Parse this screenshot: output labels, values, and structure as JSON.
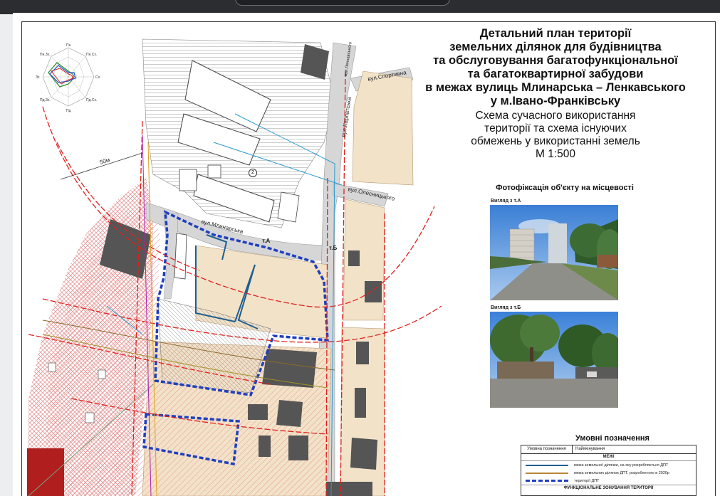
{
  "title": {
    "line1": "Детальний план території",
    "line2": "земельних ділянок для будівництва",
    "line3": "та обслуговування багатофункціональної",
    "line4": "та багатоквартирної забудови",
    "line5": "в межах вулиць Млинарська – Ленкавського",
    "line6": "у м.Івано-Франківську"
  },
  "subtitle": {
    "line1": "Схема сучасного використання",
    "line2": "території та схема існуючих",
    "line3": "обмежень у використанні земель",
    "line4": "М 1:500"
  },
  "photos": {
    "heading": "Фотофіксація об'єкту на місцевості",
    "caption_a": "Вигляд з т.А",
    "caption_b": "Вигляд з т.Б"
  },
  "streets": {
    "mlynarska": "вул.Млинарська",
    "karpatska": "вул.Карпатська",
    "sportyvna": "вул.Спортивна",
    "olesnytskoho": "вул.Олесницького",
    "lenkavskoho": "вул.Ленкавського"
  },
  "map_marks": {
    "point_a": "т.А",
    "point_b": "т.Б",
    "distance": "50м",
    "zone_number": "2"
  },
  "wind_rose": {
    "north": "Пн",
    "north_east": "Пн.Сх.",
    "east": "Сх",
    "south_east": "Пд.Сх.",
    "south": "Пд",
    "south_west": "Пд.Зх.",
    "west": "Зх",
    "north_west": "Пн.Зх."
  },
  "legend": {
    "title": "Умовні позначення",
    "col_symbol": "Умовна позначення",
    "col_name": "Найменування",
    "group_bounds": "МЕЖІ",
    "row1": "межа земельної ділянки, на яку розробляється ДПТ",
    "row2": "межа земельних ділянок ДПТ, розробленого в 2020р",
    "row3": "території ДПТ",
    "group_zoning": "ФУНКЦІОНАЛЬНЕ ЗОНУВАННЯ ТЕРИТОРІЇ"
  },
  "colors": {
    "plan_boundary": "#1f3fbf",
    "plot_boundary": "#1f5f8f",
    "restriction_line": "#e0201e",
    "hatch_red": "#e07a7a",
    "zone_fill": "#f2e2c8",
    "road_gray": "#c8c8c8",
    "building": "#555555",
    "red_building": "#b01e1e"
  }
}
